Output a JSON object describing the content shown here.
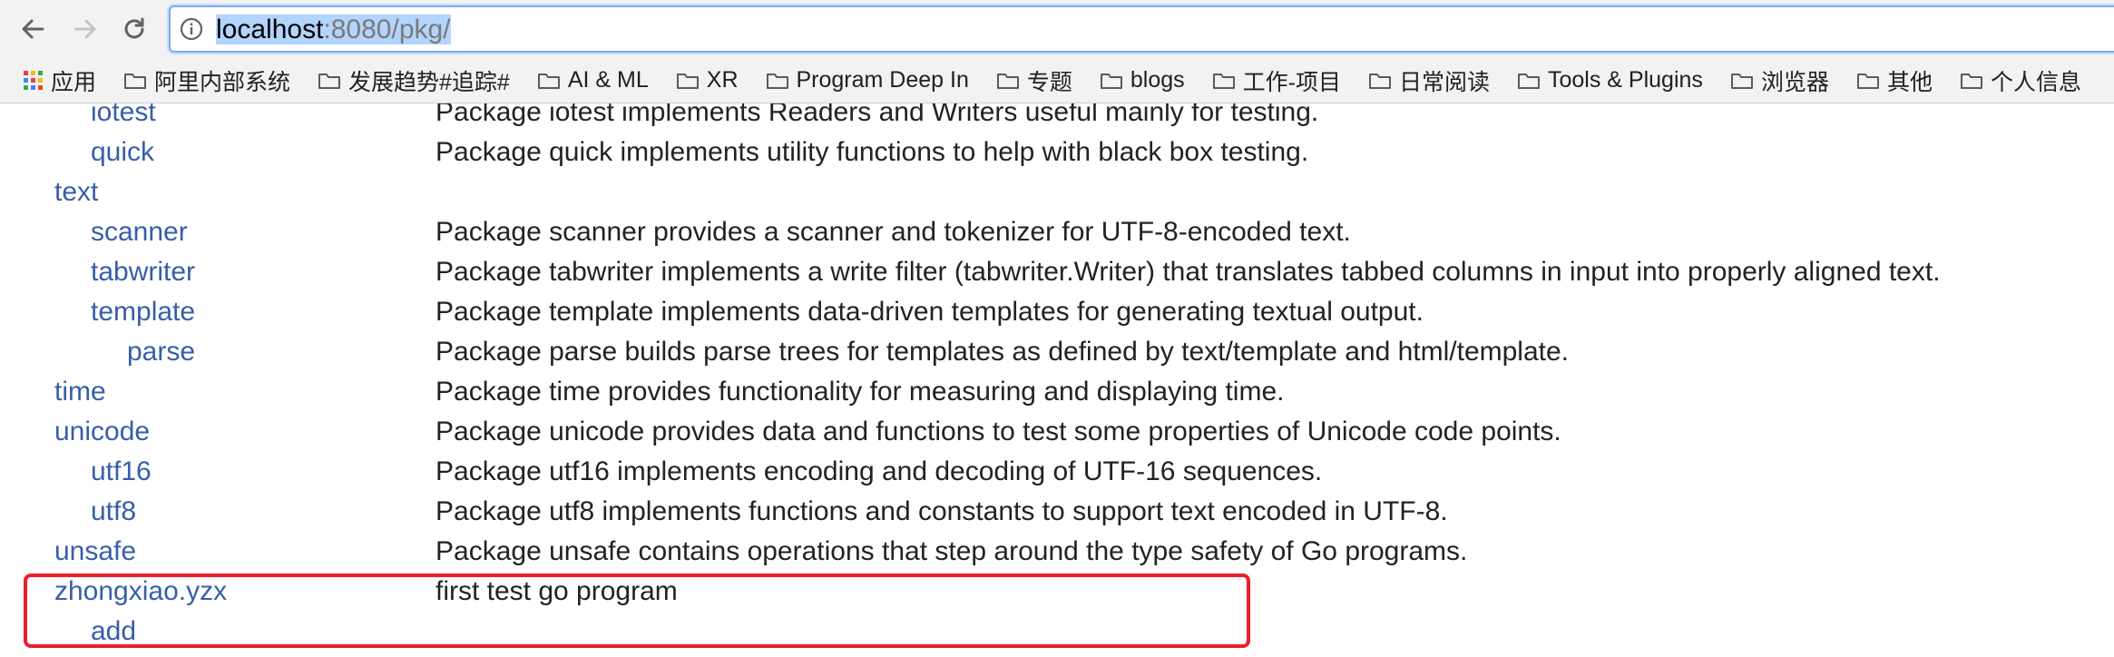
{
  "browser": {
    "url_host": "localhost",
    "url_rest": ":8080/pkg/",
    "bookmarks": [
      {
        "label": "应用",
        "icon": "apps-grid-icon"
      },
      {
        "label": "阿里内部系统",
        "icon": "folder-icon"
      },
      {
        "label": "发展趋势#追踪#",
        "icon": "folder-icon"
      },
      {
        "label": "AI & ML",
        "icon": "folder-icon"
      },
      {
        "label": "XR",
        "icon": "folder-icon"
      },
      {
        "label": "Program Deep In",
        "icon": "folder-icon"
      },
      {
        "label": "专题",
        "icon": "folder-icon"
      },
      {
        "label": "blogs",
        "icon": "folder-icon"
      },
      {
        "label": "工作-项目",
        "icon": "folder-icon"
      },
      {
        "label": "日常阅读",
        "icon": "folder-icon"
      },
      {
        "label": "Tools & Plugins",
        "icon": "folder-icon"
      },
      {
        "label": "浏览器",
        "icon": "folder-icon"
      },
      {
        "label": "其他",
        "icon": "folder-icon"
      },
      {
        "label": "个人信息",
        "icon": "folder-icon"
      }
    ]
  },
  "packages": [
    {
      "name": "iotest",
      "synopsis": "Package iotest implements Readers and Writers useful mainly for testing."
    },
    {
      "name": "quick",
      "synopsis": "Package quick implements utility functions to help with black box testing."
    },
    {
      "name": "text",
      "synopsis": ""
    },
    {
      "name": "scanner",
      "synopsis": "Package scanner provides a scanner and tokenizer for UTF-8-encoded text."
    },
    {
      "name": "tabwriter",
      "synopsis": "Package tabwriter implements a write filter (tabwriter.Writer) that translates tabbed columns in input into properly aligned text."
    },
    {
      "name": "template",
      "synopsis": "Package template implements data-driven templates for generating textual output."
    },
    {
      "name": "parse",
      "synopsis": "Package parse builds parse trees for templates as defined by text/template and html/template."
    },
    {
      "name": "time",
      "synopsis": "Package time provides functionality for measuring and displaying time."
    },
    {
      "name": "unicode",
      "synopsis": "Package unicode provides data and functions to test some properties of Unicode code points."
    },
    {
      "name": "utf16",
      "synopsis": "Package utf16 implements encoding and decoding of UTF-16 sequences."
    },
    {
      "name": "utf8",
      "synopsis": "Package utf8 implements functions and constants to support text encoded in UTF-8."
    },
    {
      "name": "unsafe",
      "synopsis": "Package unsafe contains operations that step around the type safety of Go programs."
    },
    {
      "name": "zhongxiao.yzx",
      "synopsis": "first test go program"
    },
    {
      "name": "add",
      "synopsis": ""
    }
  ],
  "colors": {
    "link": "#375eab",
    "text": "#222222",
    "annotation": "#e8202a"
  }
}
